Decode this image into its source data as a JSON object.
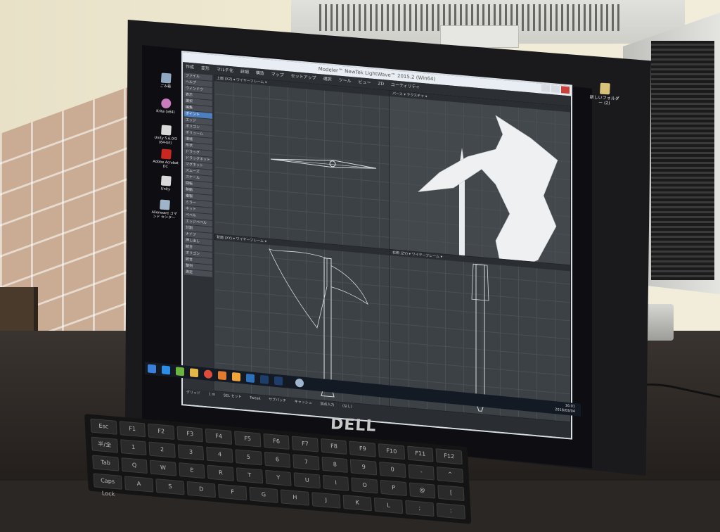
{
  "monitor": {
    "brand": "DELL"
  },
  "desktop_icons": [
    {
      "label": "ごみ箱",
      "icon": "recycle-bin-icon"
    },
    {
      "label": "Krita (x64)",
      "icon": "krita-icon"
    },
    {
      "label": "Unity 5.6.0f3 (64-bit)",
      "icon": "unity-icon"
    },
    {
      "label": "Adobe Acrobat DC",
      "icon": "acrobat-icon"
    },
    {
      "label": "Unity",
      "icon": "unity-icon"
    },
    {
      "label": "Alienware コマンド センター",
      "icon": "alienware-icon"
    }
  ],
  "right_icon": {
    "label": "新しいフォルダー (2)",
    "icon": "folder-icon"
  },
  "app": {
    "title": "Modeler™ NewTek LightWave™ 2015.2 (Win64)",
    "menu": [
      "作成",
      "変形",
      "マルチ化",
      "詳細",
      "構造",
      "マップ",
      "セットアップ",
      "選択",
      "ツール",
      "ビュー",
      "ZD",
      "ユーティリティ"
    ],
    "tools": [
      "ファイル",
      "ヘルプ",
      "ウィンドウ",
      "表示",
      "選択",
      "編集",
      "ポイント",
      "エッジ",
      "ポリゴン",
      "ボリューム",
      "環境",
      "形状",
      "ドラッグ",
      "ドラッグネット",
      "マグネット",
      "スムーズ",
      "スケール",
      "回転",
      "移動",
      "複製",
      "ミラー",
      "ネット",
      "ベベル",
      "エッジベベル",
      "分割",
      "ナイフ",
      "押し出し",
      "結合",
      "ポリゴン",
      "統合",
      "整列",
      "測定"
    ],
    "viewports": [
      {
        "label": "上面 (XZ) ▾ ワイヤーフレーム ▾"
      },
      {
        "label": "パース ▾ テクスチャ ▾"
      },
      {
        "label": "背面 (XY) ▾ ワイヤーフレーム ▾"
      },
      {
        "label": "右側 (ZY) ▾ ワイヤーフレーム ▾"
      }
    ],
    "status": [
      "グリッド",
      "1 m",
      "SEL セット",
      "Tweak",
      "サブパッチ",
      "キャッシュ",
      "頂点入力",
      "(なし)"
    ]
  },
  "taskbar": {
    "time": "16:01",
    "date": "2018/03/04"
  },
  "keyboard": {
    "row1": [
      "Esc",
      "F1",
      "F2",
      "F3",
      "F4",
      "F5",
      "F6",
      "F7",
      "F8",
      "F9",
      "F10",
      "F11",
      "F12"
    ],
    "row2": [
      "半/全",
      "1",
      "2",
      "3",
      "4",
      "5",
      "6",
      "7",
      "8",
      "9",
      "0",
      "-",
      "^"
    ],
    "row3": [
      "Tab",
      "Q",
      "W",
      "E",
      "R",
      "T",
      "Y",
      "U",
      "I",
      "O",
      "P",
      "@",
      "["
    ],
    "row4": [
      "Caps Lock",
      "A",
      "S",
      "D",
      "F",
      "G",
      "H",
      "J",
      "K",
      "L",
      ";",
      ":"
    ]
  }
}
